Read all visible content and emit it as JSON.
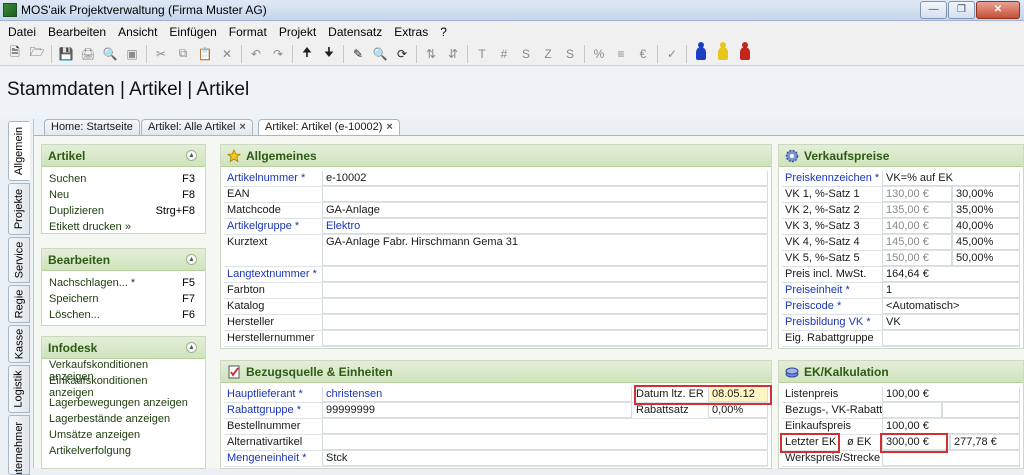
{
  "window": {
    "title": "MOS'aik Projektverwaltung (Firma Muster AG)"
  },
  "menu": [
    "Datei",
    "Bearbeiten",
    "Ansicht",
    "Einfügen",
    "Format",
    "Projekt",
    "Datensatz",
    "Extras",
    "?"
  ],
  "page_title": "Stammdaten | Artikel | Artikel",
  "side_tabs": [
    "Allgemein",
    "Projekte",
    "Service",
    "Regie",
    "Kasse",
    "Logistik",
    "Unternehmer"
  ],
  "doc_tabs": [
    "Home: Startseite",
    "Artikel: Alle Artikel",
    "Artikel: Artikel (e-10002)"
  ],
  "sidebar": {
    "artikel": {
      "title": "Artikel",
      "items": [
        {
          "label": "Suchen",
          "key": "F3"
        },
        {
          "label": "Neu",
          "key": "F8"
        },
        {
          "label": "Duplizieren",
          "key": "Strg+F8"
        },
        {
          "label": "Etikett drucken »",
          "key": ""
        }
      ]
    },
    "bearbeiten": {
      "title": "Bearbeiten",
      "items": [
        {
          "label": "Nachschlagen... *",
          "key": "F5"
        },
        {
          "label": "Speichern",
          "key": "F7"
        },
        {
          "label": "Löschen...",
          "key": "F6"
        }
      ]
    },
    "infodesk": {
      "title": "Infodesk",
      "items": [
        "Verkaufskonditionen anzeigen",
        "Einkaufskonditionen anzeigen",
        "Lagerbewegungen anzeigen",
        "Lagerbestände anzeigen",
        "Umsätze anzeigen",
        "Artikelverfolgung"
      ]
    }
  },
  "allgemeines": {
    "title": "Allgemeines",
    "rows": [
      {
        "label": "Artikelnummer *",
        "value": "e-10002"
      },
      {
        "label": "EAN",
        "value": ""
      },
      {
        "label": "Matchcode",
        "value": "GA-Anlage"
      },
      {
        "label": "Artikelgruppe *",
        "value": "Elektro"
      },
      {
        "label": "Kurztext",
        "value": "GA-Anlage Fabr. Hirschmann Gema 31"
      },
      {
        "label": "Langtextnummer *",
        "value": ""
      },
      {
        "label": "Farbton",
        "value": ""
      },
      {
        "label": "Katalog",
        "value": ""
      },
      {
        "label": "Hersteller",
        "value": ""
      },
      {
        "label": "Herstellernummer",
        "value": ""
      }
    ]
  },
  "verkaufspreise": {
    "title": "Verkaufspreise",
    "preiskennzeichen": {
      "label": "Preiskennzeichen *",
      "value": "VK=% auf EK"
    },
    "vk_rows": [
      {
        "label": "VK 1, %-Satz 1",
        "price": "130,00 €",
        "pct": "30,00%"
      },
      {
        "label": "VK 2, %-Satz 2",
        "price": "135,00 €",
        "pct": "35,00%"
      },
      {
        "label": "VK 3, %-Satz 3",
        "price": "140,00 €",
        "pct": "40,00%"
      },
      {
        "label": "VK 4, %-Satz 4",
        "price": "145,00 €",
        "pct": "45,00%"
      },
      {
        "label": "VK 5, %-Satz 5",
        "price": "150,00 €",
        "pct": "50,00%"
      }
    ],
    "rows": [
      {
        "label": "Preis incl. MwSt.",
        "value": "164,64 €"
      },
      {
        "label": "Preiseinheit *",
        "value": "1"
      },
      {
        "label": "Preiscode *",
        "value": "<Automatisch>"
      },
      {
        "label": "Preisbildung VK *",
        "value": "VK"
      },
      {
        "label": "Eig. Rabattgruppe",
        "value": ""
      }
    ]
  },
  "bezugsquelle": {
    "title": "Bezugsquelle & Einheiten",
    "rows": [
      {
        "label": "Hauptlieferant *",
        "value": "christensen"
      },
      {
        "label": "Rabattgruppe *",
        "value": "99999999"
      },
      {
        "label": "Bestellnummer",
        "value": ""
      },
      {
        "label": "Alternativartikel",
        "value": ""
      },
      {
        "label": "Mengeneinheit *",
        "value": "Stck"
      }
    ],
    "datum_label": "Datum ltz. ER",
    "datum_value": "08.05.12",
    "rabattsatz_label": "Rabattsatz",
    "rabattsatz_value": "0,00%"
  },
  "ek": {
    "title": "EK/Kalkulation",
    "rows": [
      {
        "label": "Listenpreis",
        "value": "100,00 €"
      },
      {
        "label": "Bezugs-, VK-Rabatt",
        "value": ""
      },
      {
        "label": "Einkaufspreis",
        "value": "100,00 €"
      }
    ],
    "letzter_label": "Letzter EK",
    "oek_label": "ø EK",
    "letzter_value": "300,00 €",
    "oek_value": "277,78 €",
    "werkspreis_label": "Werkspreis/Strecke"
  }
}
